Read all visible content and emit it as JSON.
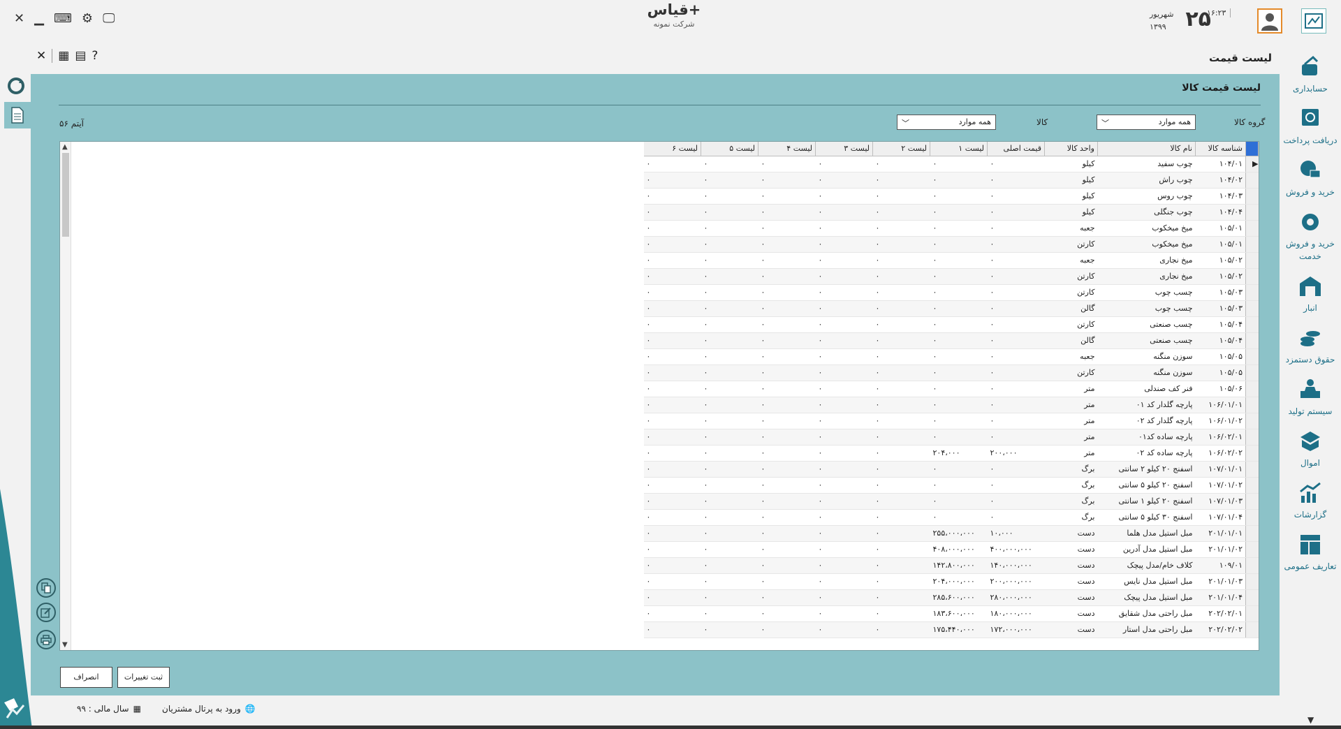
{
  "window": {
    "app_name": "قیاس+",
    "company": "شرکت نمونه",
    "date_day": "۲۵",
    "date_month": "شهریور",
    "date_year": "۱۳۹۹",
    "time": "۱۶:۲۳"
  },
  "subbar": {
    "title": "لیست قیمت"
  },
  "sidebar": {
    "items": [
      {
        "label": "حسابداری",
        "icon": "accounting-icon"
      },
      {
        "label": "دریافت پرداخت",
        "icon": "payment-icon"
      },
      {
        "label": "خرید و فروش",
        "icon": "trade-icon"
      },
      {
        "label": "خرید و فروش",
        "label2": "خدمت",
        "icon": "service-icon"
      },
      {
        "label": "انبار",
        "icon": "warehouse-icon"
      },
      {
        "label": "حقوق دستمزد",
        "icon": "payroll-icon"
      },
      {
        "label": "سیستم تولید",
        "icon": "production-icon"
      },
      {
        "label": "اموال",
        "icon": "assets-icon"
      },
      {
        "label": "گزارشات",
        "icon": "reports-icon"
      },
      {
        "label": "تعاریف عمومی",
        "icon": "definitions-icon"
      }
    ]
  },
  "panel": {
    "title": "لیست قیمت کالا",
    "group_label": "گروه کالا",
    "group_value": "همه موارد",
    "item_label": "کالا",
    "item_value": "همه موارد",
    "count_text": "۵۶ آیتم"
  },
  "table": {
    "headers": [
      "شناسه کالا",
      "نام کالا",
      "واحد کالا",
      "قیمت اصلی",
      "لیست ۱",
      "لیست ۲",
      "لیست ۳",
      "لیست ۴",
      "لیست ۵",
      "لیست ۶"
    ],
    "rows": [
      [
        "۱۰۴/۰۱",
        "چوب سفید",
        "کیلو",
        "۰",
        "۰",
        "۰",
        "۰",
        "۰",
        "۰",
        "۰"
      ],
      [
        "۱۰۴/۰۲",
        "چوب راش",
        "کیلو",
        "۰",
        "۰",
        "۰",
        "۰",
        "۰",
        "۰",
        "۰"
      ],
      [
        "۱۰۴/۰۳",
        "چوب روس",
        "کیلو",
        "۰",
        "۰",
        "۰",
        "۰",
        "۰",
        "۰",
        "۰"
      ],
      [
        "۱۰۴/۰۴",
        "چوب جنگلی",
        "کیلو",
        "۰",
        "۰",
        "۰",
        "۰",
        "۰",
        "۰",
        "۰"
      ],
      [
        "۱۰۵/۰۱",
        "میخ میخکوب",
        "جعبه",
        "۰",
        "۰",
        "۰",
        "۰",
        "۰",
        "۰",
        "۰"
      ],
      [
        "۱۰۵/۰۱",
        "میخ میخکوب",
        "کارتن",
        "۰",
        "۰",
        "۰",
        "۰",
        "۰",
        "۰",
        "۰"
      ],
      [
        "۱۰۵/۰۲",
        "میخ نجاری",
        "جعبه",
        "۰",
        "۰",
        "۰",
        "۰",
        "۰",
        "۰",
        "۰"
      ],
      [
        "۱۰۵/۰۲",
        "میخ نجاری",
        "کارتن",
        "۰",
        "۰",
        "۰",
        "۰",
        "۰",
        "۰",
        "۰"
      ],
      [
        "۱۰۵/۰۳",
        "چسب چوب",
        "کارتن",
        "۰",
        "۰",
        "۰",
        "۰",
        "۰",
        "۰",
        "۰"
      ],
      [
        "۱۰۵/۰۳",
        "چسب چوب",
        "گالن",
        "۰",
        "۰",
        "۰",
        "۰",
        "۰",
        "۰",
        "۰"
      ],
      [
        "۱۰۵/۰۴",
        "چسب صنعتی",
        "کارتن",
        "۰",
        "۰",
        "۰",
        "۰",
        "۰",
        "۰",
        "۰"
      ],
      [
        "۱۰۵/۰۴",
        "چسب صنعتی",
        "گالن",
        "۰",
        "۰",
        "۰",
        "۰",
        "۰",
        "۰",
        "۰"
      ],
      [
        "۱۰۵/۰۵",
        "سوزن منگنه",
        "جعبه",
        "۰",
        "۰",
        "۰",
        "۰",
        "۰",
        "۰",
        "۰"
      ],
      [
        "۱۰۵/۰۵",
        "سوزن منگنه",
        "کارتن",
        "۰",
        "۰",
        "۰",
        "۰",
        "۰",
        "۰",
        "۰"
      ],
      [
        "۱۰۵/۰۶",
        "فنر کف صندلی",
        "متر",
        "۰",
        "۰",
        "۰",
        "۰",
        "۰",
        "۰",
        "۰"
      ],
      [
        "۱۰۶/۰۱/۰۱",
        "پارچه گلدار کد ۰۱",
        "متر",
        "۰",
        "۰",
        "۰",
        "۰",
        "۰",
        "۰",
        "۰"
      ],
      [
        "۱۰۶/۰۱/۰۲",
        "پارچه گلدار کد ۰۲",
        "متر",
        "۰",
        "۰",
        "۰",
        "۰",
        "۰",
        "۰",
        "۰"
      ],
      [
        "۱۰۶/۰۲/۰۱",
        "پارچه ساده کد۰۱",
        "متر",
        "۰",
        "۰",
        "۰",
        "۰",
        "۰",
        "۰",
        "۰"
      ],
      [
        "۱۰۶/۰۲/۰۲",
        "پارچه ساده کد ۰۲",
        "متر",
        "۲۰۰،۰۰۰",
        "۲۰۴،۰۰۰",
        "۰",
        "۰",
        "۰",
        "۰",
        "۰"
      ],
      [
        "۱۰۷/۰۱/۰۱",
        "اسفنج ۲۰ کیلو ۲ سانتی",
        "برگ",
        "۰",
        "۰",
        "۰",
        "۰",
        "۰",
        "۰",
        "۰"
      ],
      [
        "۱۰۷/۰۱/۰۲",
        "اسفنج ۲۰ کیلو ۵ سانتی",
        "برگ",
        "۰",
        "۰",
        "۰",
        "۰",
        "۰",
        "۰",
        "۰"
      ],
      [
        "۱۰۷/۰۱/۰۳",
        "اسفنج ۲۰ کیلو ۱ سانتی",
        "برگ",
        "۰",
        "۰",
        "۰",
        "۰",
        "۰",
        "۰",
        "۰"
      ],
      [
        "۱۰۷/۰۱/۰۴",
        "اسفنج ۳۰ کیلو ۵ سانتی",
        "برگ",
        "۰",
        "۰",
        "۰",
        "۰",
        "۰",
        "۰",
        "۰"
      ],
      [
        "۲۰۱/۰۱/۰۱",
        "مبل استیل مدل هلما",
        "دست",
        "۱۰،۰۰۰",
        "۲۵۵،۰۰۰،۰۰۰",
        "۰",
        "۰",
        "۰",
        "۰",
        "۰"
      ],
      [
        "۲۰۱/۰۱/۰۲",
        "مبل استیل مدل آدرین",
        "دست",
        "۴۰۰،۰۰۰،۰۰۰",
        "۴۰۸،۰۰۰،۰۰۰",
        "۰",
        "۰",
        "۰",
        "۰",
        "۰"
      ],
      [
        "۱۰۹/۰۱",
        "کلاف خام/مدل پیچک",
        "دست",
        "۱۴۰،۰۰۰،۰۰۰",
        "۱۴۲،۸۰۰،۰۰۰",
        "۰",
        "۰",
        "۰",
        "۰",
        "۰"
      ],
      [
        "۲۰۱/۰۱/۰۳",
        "مبل استیل مدل نایس",
        "دست",
        "۲۰۰،۰۰۰،۰۰۰",
        "۲۰۴،۰۰۰،۰۰۰",
        "۰",
        "۰",
        "۰",
        "۰",
        "۰"
      ],
      [
        "۲۰۱/۰۱/۰۴",
        "مبل استیل مدل پیچک",
        "دست",
        "۲۸۰،۰۰۰،۰۰۰",
        "۲۸۵،۶۰۰،۰۰۰",
        "۰",
        "۰",
        "۰",
        "۰",
        "۰"
      ],
      [
        "۲۰۲/۰۲/۰۱",
        "مبل راحتی مدل شقایق",
        "دست",
        "۱۸۰،۰۰۰،۰۰۰",
        "۱۸۳،۶۰۰،۰۰۰",
        "۰",
        "۰",
        "۰",
        "۰",
        "۰"
      ],
      [
        "۲۰۲/۰۲/۰۲",
        "مبل راحتی مدل استار",
        "دست",
        "۱۷۲،۰۰۰،۰۰۰",
        "۱۷۵،۴۴۰،۰۰۰",
        "۰",
        "۰",
        "۰",
        "۰",
        "۰"
      ]
    ]
  },
  "buttons": {
    "save": "ثبت تغییرات",
    "cancel": "انصراف"
  },
  "status": {
    "portal": "ورود به پرتال مشتریان",
    "fiscal_year": "سال مالی : ۹۹"
  },
  "colors": {
    "panel": "#8cc2c8",
    "accent": "#1d6f87",
    "selection": "#2e6fd6"
  }
}
